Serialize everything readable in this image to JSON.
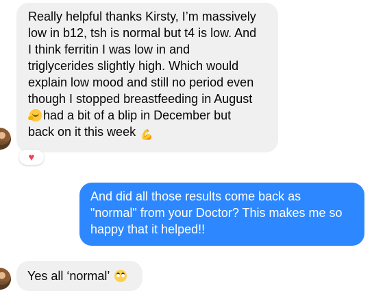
{
  "messages": [
    {
      "direction": "received",
      "lines": [
        "Really helpful thanks Kirsty, I’m massively",
        "low in b12, tsh is normal but t4 is low. And",
        "I think  ferritin I was low in and",
        "triglycerides slightly high. Which would",
        "explain low mood and still no period even",
        "though I stopped breastfeeding in August"
      ],
      "line7_text": "had a bit of a blip in December but",
      "line8_text": "back on it this week",
      "emoji_line7": "hugging-face-emoji",
      "emoji_line8": "flexed-biceps-emoji",
      "reaction": "heart"
    },
    {
      "direction": "sent",
      "lines": [
        "And did all those results come back as",
        "\"normal\" from your Doctor? This makes me so",
        "happy that it helped!!"
      ]
    },
    {
      "direction": "received",
      "text": "Yes all ‘normal’",
      "emoji": "face-with-rolling-eyes-emoji"
    }
  ],
  "colors": {
    "received_bubble": "#f0f0f0",
    "sent_bubble": "#2d88ff",
    "text_dark": "#050505",
    "reaction_heart": "#f33e58"
  }
}
